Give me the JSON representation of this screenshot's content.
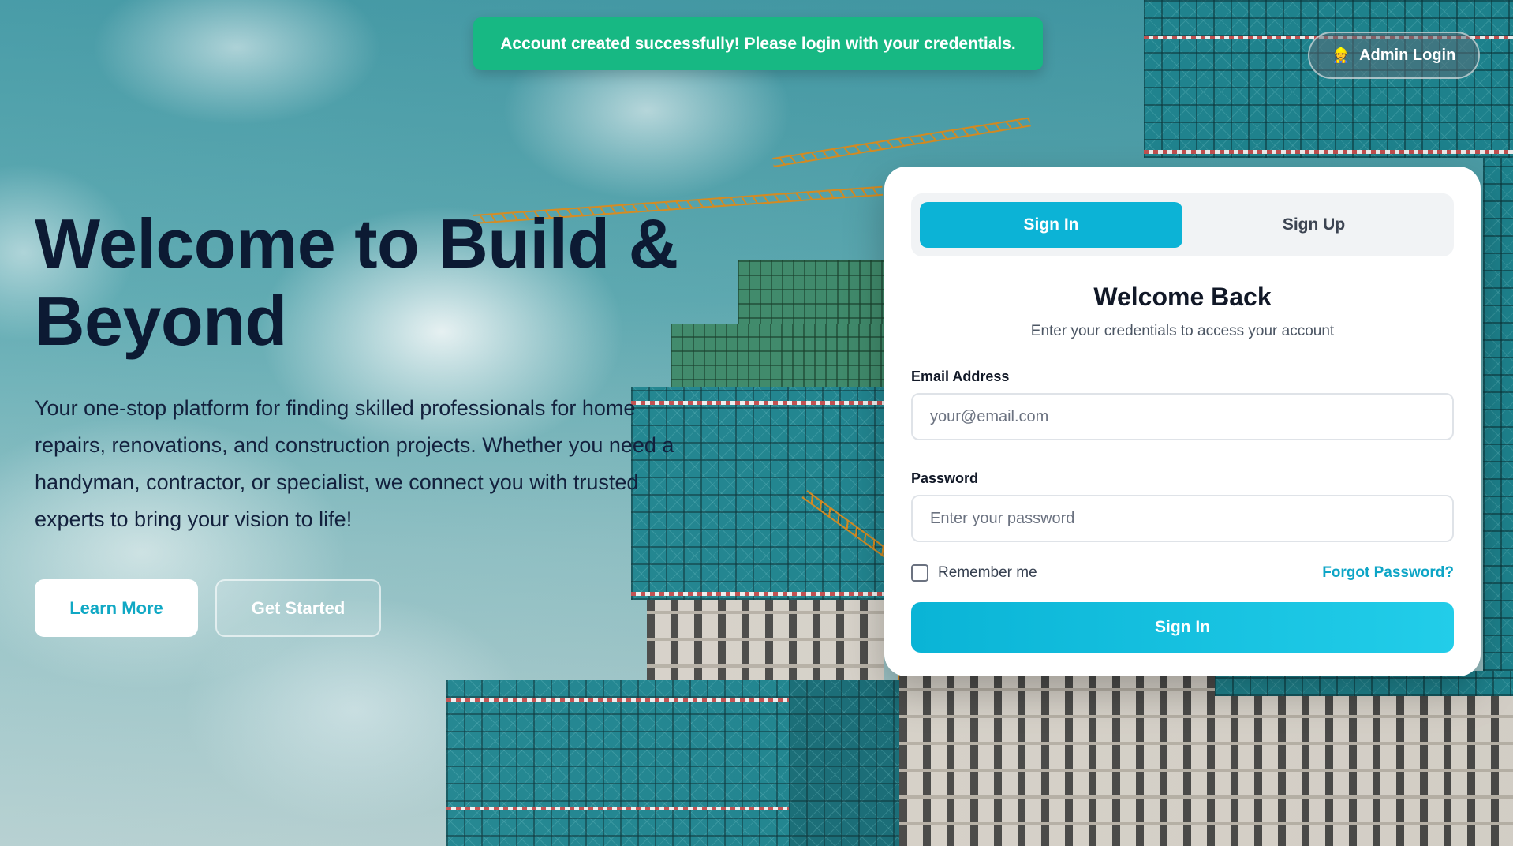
{
  "toast": {
    "message": "Account created successfully! Please login with your credentials."
  },
  "admin": {
    "label": "Admin Login",
    "icon": "admin-person-icon"
  },
  "hero": {
    "title": "Welcome to Build & Beyond",
    "description": "Your one-stop platform for finding skilled professionals for home repairs, renovations, and construction projects. Whether you need a handyman, contractor, or specialist, we connect you with trusted experts to bring your vision to life!",
    "learn_more": "Learn More",
    "get_started": "Get Started"
  },
  "auth": {
    "tabs": [
      {
        "label": "Sign In",
        "active": true
      },
      {
        "label": "Sign Up",
        "active": false
      }
    ],
    "title": "Welcome Back",
    "subtitle": "Enter your credentials to access your account",
    "email_label": "Email Address",
    "email_placeholder": "your@email.com",
    "email_value": "",
    "password_label": "Password",
    "password_placeholder": "Enter your password",
    "password_value": "",
    "remember_label": "Remember me",
    "remember_checked": false,
    "forgot_label": "Forgot Password?",
    "submit_label": "Sign In"
  },
  "colors": {
    "accent": "#0cb3d6",
    "toast_bg": "#17b883",
    "heading": "#0c1a33"
  }
}
